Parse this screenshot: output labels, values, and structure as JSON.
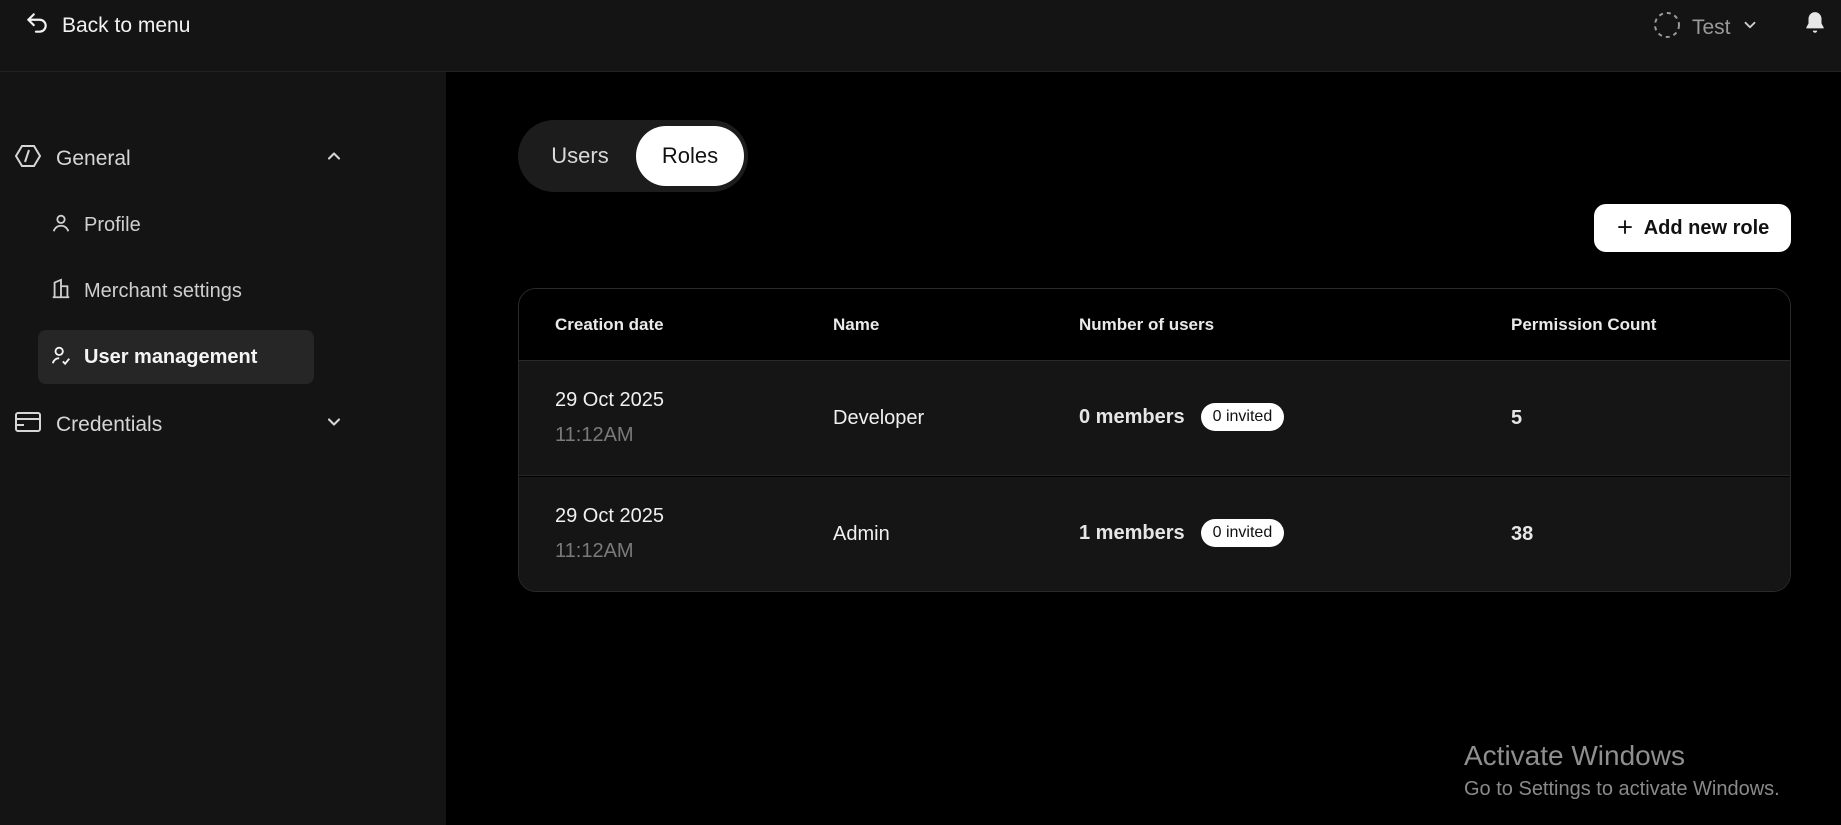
{
  "topbar": {
    "back_label": "Back to menu",
    "env_label": "Test"
  },
  "sidebar": {
    "groups": [
      {
        "label": "General",
        "expanded": true,
        "icon": "hexagon-icon"
      },
      {
        "label": "Credentials",
        "expanded": false,
        "icon": "credentials-icon"
      }
    ],
    "items": [
      {
        "label": "Profile",
        "icon": "user-icon"
      },
      {
        "label": "Merchant settings",
        "icon": "building-icon"
      },
      {
        "label": "User management",
        "icon": "user-check-icon",
        "active": true
      }
    ]
  },
  "tabs": [
    {
      "label": "Users",
      "active": false
    },
    {
      "label": "Roles",
      "active": true
    }
  ],
  "actions": {
    "add_role_label": "Add new role"
  },
  "table": {
    "columns": [
      "Creation date",
      "Name",
      "Number of users",
      "Permission Count"
    ],
    "rows": [
      {
        "date": "29 Oct 2025",
        "time": "11:12AM",
        "name": "Developer",
        "members": "0 members",
        "invited": "0 invited",
        "permissions": "5"
      },
      {
        "date": "29 Oct 2025",
        "time": "11:12AM",
        "name": "Admin",
        "members": "1 members",
        "invited": "0 invited",
        "permissions": "38"
      }
    ]
  },
  "watermark": {
    "title": "Activate Windows",
    "subtitle": "Go to Settings to activate Windows."
  },
  "colors": {
    "background": "#000000",
    "sidebar": "#141414",
    "accent": "#ffffff"
  }
}
